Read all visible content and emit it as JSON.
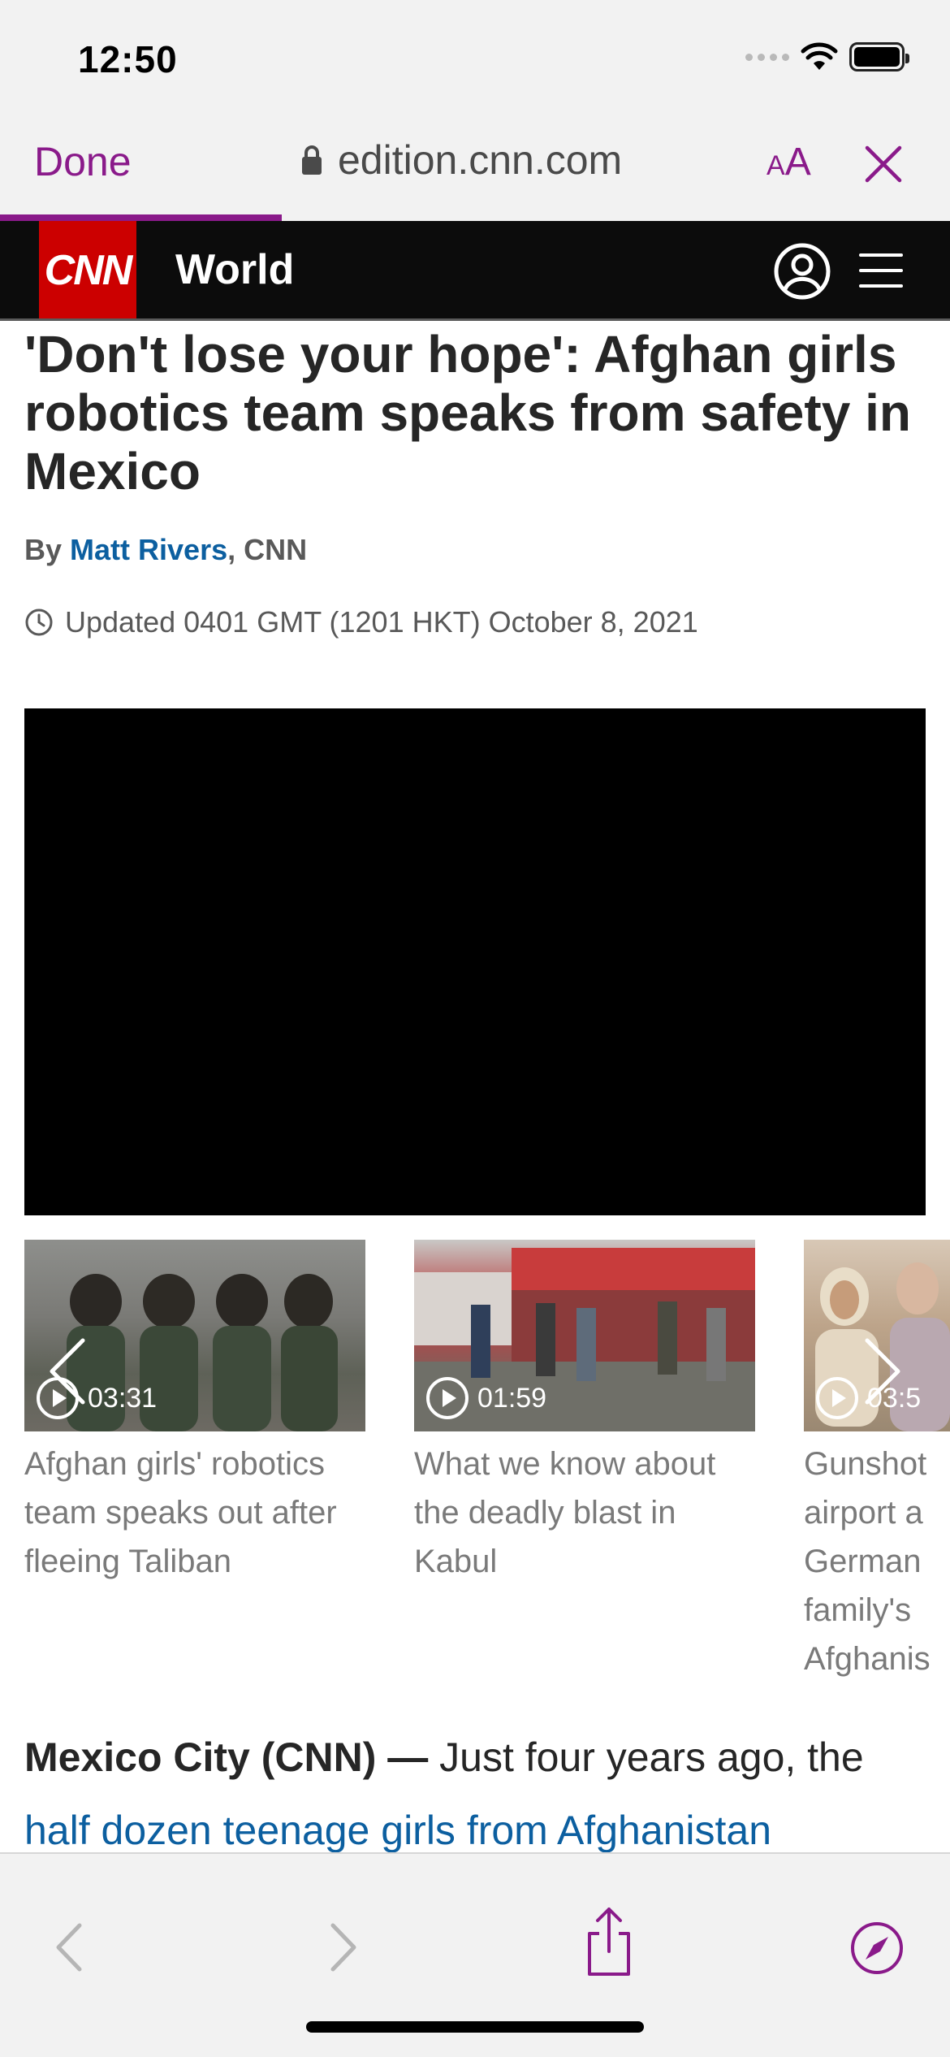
{
  "status_bar": {
    "time": "12:50"
  },
  "browser": {
    "done_label": "Done",
    "url": "edition.cnn.com",
    "text_size_small": "A",
    "text_size_big": "A",
    "accent_color": "#8a1a8a"
  },
  "cnn_nav": {
    "logo_text": "CNN",
    "section": "World"
  },
  "article": {
    "headline": "'Don't lose your hope': Afghan girls robotics team speaks from safety in Mexico",
    "byline_prefix": "By ",
    "author": "Matt Rivers",
    "byline_suffix": ", CNN",
    "updated": "Updated 0401 GMT (1201 HKT) October 8, 2021",
    "lead_dateline": "Mexico City (CNN) —",
    "lead_text_1": " Just four years ago, the ",
    "lead_link": "half dozen teenage girls from Afghanistan"
  },
  "carousel": {
    "items": [
      {
        "duration": "03:31",
        "title": "Afghan girls' robotics team speaks out after fleeing Taliban"
      },
      {
        "duration": "01:59",
        "title": "What we know about the deadly blast in Kabul"
      },
      {
        "duration": "03:5",
        "title": "Gunshot airport a German family's Afghanis"
      }
    ]
  },
  "toolbar": {
    "icons": [
      "back-icon",
      "forward-icon",
      "share-icon",
      "compass-icon"
    ]
  }
}
